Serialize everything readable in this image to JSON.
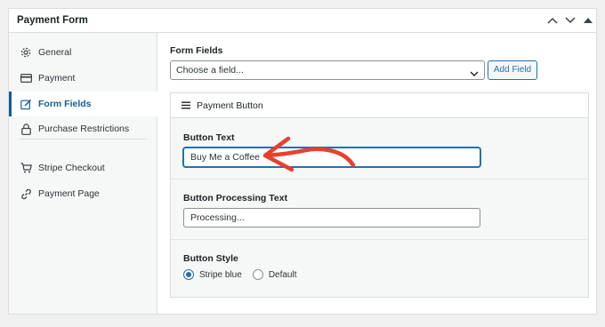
{
  "panel": {
    "title": "Payment Form"
  },
  "sidebar": {
    "items": [
      {
        "label": "General",
        "icon": "gear-icon"
      },
      {
        "label": "Payment",
        "icon": "card-icon"
      },
      {
        "label": "Form Fields",
        "icon": "pencil-square-icon",
        "active": true
      },
      {
        "label": "Purchase Restrictions",
        "icon": "lock-icon"
      },
      {
        "label": "Stripe Checkout",
        "icon": "cart-icon"
      },
      {
        "label": "Payment Page",
        "icon": "link-icon"
      }
    ]
  },
  "form_fields": {
    "label": "Form Fields",
    "select_value": "Choose a field...",
    "add_button": "Add Field"
  },
  "payment_button_box": {
    "title": "Payment Button",
    "button_text": {
      "label": "Button Text",
      "value": "Buy Me a Coffee"
    },
    "processing_text": {
      "label": "Button Processing Text",
      "value": "Processing..."
    },
    "style": {
      "label": "Button Style",
      "options": [
        {
          "label": "Stripe blue",
          "checked": true
        },
        {
          "label": "Default",
          "checked": false
        }
      ]
    }
  },
  "colors": {
    "accent": "#2271b1",
    "annotation_arrow": "#e8402c"
  }
}
